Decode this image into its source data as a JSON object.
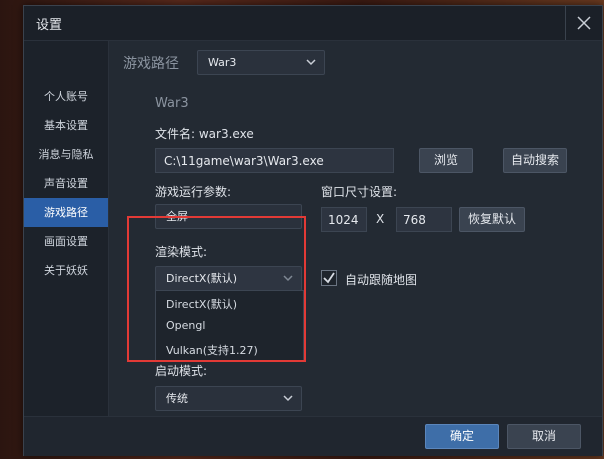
{
  "window": {
    "title": "设置"
  },
  "sidebar": {
    "items": [
      {
        "label": "个人账号"
      },
      {
        "label": "基本设置"
      },
      {
        "label": "消息与隐私"
      },
      {
        "label": "声音设置"
      },
      {
        "label": "游戏路径"
      },
      {
        "label": "画面设置"
      },
      {
        "label": "关于妖妖"
      }
    ],
    "active_index": 4
  },
  "main": {
    "section_title": "游戏路径",
    "game_select": "War3",
    "game_name": "War3",
    "file_name_label": "文件名: war3.exe",
    "path_value": "C:\\11game\\war3\\War3.exe",
    "browse_label": "浏览",
    "auto_search_label": "自动搜索",
    "run_params_label": "游戏运行参数:",
    "run_params_value": "全屏",
    "window_size_label": "窗口尺寸设置:",
    "width_value": "1024",
    "x_sep": "X",
    "height_value": "768",
    "restore_label": "恢复默认",
    "render_mode_label": "渲染模式:",
    "render_mode_value": "DirectX(默认)",
    "render_options": [
      "DirectX(默认)",
      "Opengl",
      "Vulkan(支持1.27)"
    ],
    "follow_map_label": "自动跟随地图",
    "follow_map_checked": true,
    "launch_mode_label": "启动模式:",
    "launch_mode_value": "传统"
  },
  "footer": {
    "ok_label": "确定",
    "cancel_label": "取消"
  },
  "colors": {
    "accent": "#2a5ea6",
    "highlight_border": "#e23a36"
  }
}
